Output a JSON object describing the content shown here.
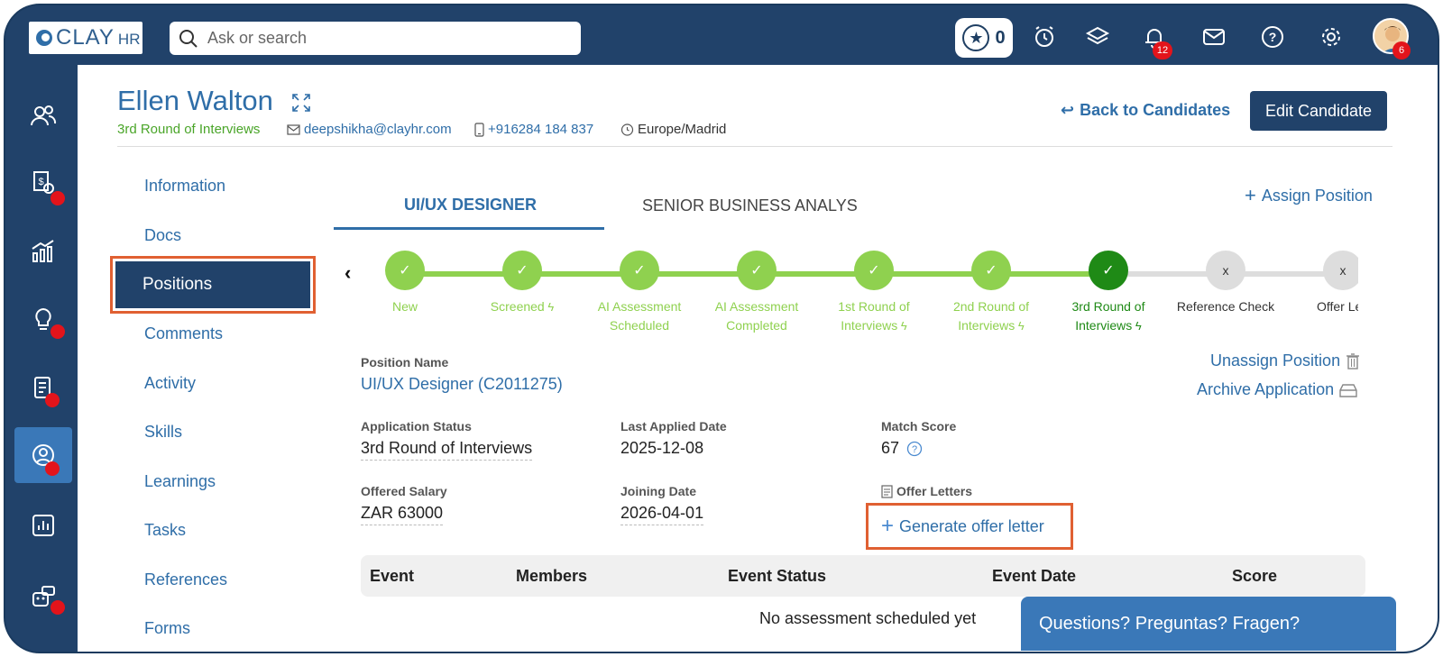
{
  "topbar": {
    "logo_text": "CLAY",
    "logo_suffix": "HR",
    "search_placeholder": "Ask or search",
    "rewards_count": "0",
    "notifications_count": "12",
    "profile_count": "6"
  },
  "candidate": {
    "name": "Ellen Walton",
    "stage": "3rd Round of Interviews",
    "email": "deepshikha@clayhr.com",
    "phone": "+916284 184 837",
    "timezone": "Europe/Madrid"
  },
  "header_actions": {
    "back_label": "Back to Candidates",
    "edit_label": "Edit Candidate"
  },
  "subnav": {
    "items": [
      "Information",
      "Docs",
      "Positions",
      "Comments",
      "Activity",
      "Skills",
      "Learnings",
      "Tasks",
      "References",
      "Forms"
    ],
    "active": "Positions"
  },
  "tabs": {
    "items": [
      "UI/UX DESIGNER",
      "SENIOR BUSINESS ANALYS"
    ],
    "active_index": 0,
    "assign_label": "Assign Position"
  },
  "stepper": {
    "steps": [
      {
        "label": "New",
        "status": "done",
        "lightning": false
      },
      {
        "label": "Screened",
        "status": "done",
        "lightning": true
      },
      {
        "label": "AI Assessment Scheduled",
        "status": "done",
        "lightning": false
      },
      {
        "label": "AI Assessment Completed",
        "status": "done",
        "lightning": false
      },
      {
        "label": "1st Round of Interviews",
        "status": "done",
        "lightning": true
      },
      {
        "label": "2nd Round of Interviews",
        "status": "done",
        "lightning": true
      },
      {
        "label": "3rd Round of Interviews",
        "status": "current",
        "lightning": true
      },
      {
        "label": "Reference Check",
        "status": "pending",
        "lightning": false
      },
      {
        "label": "Offer Lett",
        "status": "pending",
        "lightning": false
      }
    ],
    "check_glyph": "✓",
    "pending_glyph": "x"
  },
  "position": {
    "name_label": "Position Name",
    "name_value": "UI/UX Designer (C2011275)",
    "unassign_label": "Unassign Position",
    "archive_label": "Archive Application",
    "status_label": "Application Status",
    "status_value": "3rd Round of Interviews",
    "last_applied_label": "Last Applied Date",
    "last_applied_value": "2025-12-08",
    "match_label": "Match Score",
    "match_value": "67",
    "salary_label": "Offered Salary",
    "salary_value": "ZAR 63000",
    "joining_label": "Joining Date",
    "joining_value": "2026-04-01",
    "offer_letters_label": "Offer Letters",
    "generate_label": "Generate offer letter"
  },
  "events_table": {
    "columns": [
      "Event",
      "Members",
      "Event Status",
      "Event Date",
      "Score"
    ],
    "empty_message": "No assessment scheduled yet"
  },
  "chat": {
    "label": "Questions? Preguntas? Fragen?"
  },
  "colors": {
    "navy": "#21426a",
    "accent_blue": "#2f6ea8",
    "stage_green": "#8fd14f",
    "current_green": "#1f8a16",
    "highlight_orange": "#e06032",
    "alert_red": "#e3141b"
  }
}
